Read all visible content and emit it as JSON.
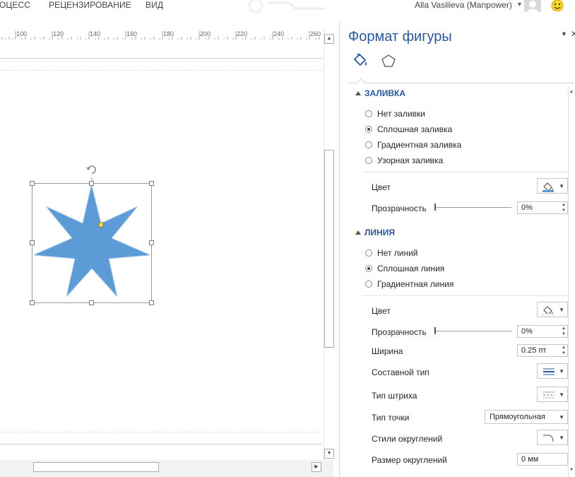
{
  "ribbon": {
    "tabs": [
      "ОЦЕСС",
      "РЕЦЕНЗИРОВАНИЕ",
      "ВИД"
    ],
    "user": "Alla Vasilieva (Manpower)"
  },
  "ruler": {
    "marks": [
      "100",
      "120",
      "140",
      "160",
      "180",
      "200",
      "220",
      "240",
      "260"
    ]
  },
  "shape": {
    "type": "7-point star",
    "fill_color": "#5b9bd5"
  },
  "panel": {
    "title": "Формат фигуры",
    "tabs": [
      "fill-and-line-icon",
      "effects-pentagon-icon"
    ],
    "fill": {
      "heading": "ЗАЛИВКА",
      "options": [
        {
          "label": "Нет заливки",
          "selected": false
        },
        {
          "label": "Сплошная заливка",
          "selected": true
        },
        {
          "label": "Градиентная заливка",
          "selected": false
        },
        {
          "label": "Узорная заливка",
          "selected": false
        }
      ],
      "color_label": "Цвет",
      "transparency_label": "Прозрачность",
      "transparency_value": "0%"
    },
    "line": {
      "heading": "ЛИНИЯ",
      "options": [
        {
          "label": "Нет линий",
          "selected": false
        },
        {
          "label": "Сплошная линия",
          "selected": true
        },
        {
          "label": "Градиентная линия",
          "selected": false
        }
      ],
      "color_label": "Цвет",
      "transparency_label": "Прозрачность",
      "transparency_value": "0%",
      "width_label": "Ширина",
      "width_value": "0.25 пт",
      "compound_label": "Составной тип",
      "dash_label": "Тип штриха",
      "cap_label": "Тип точки",
      "cap_value": "Прямоугольная",
      "round_styles_label": "Стили округлений",
      "round_size_label": "Размер округлений",
      "round_size_value": "0 мм"
    }
  },
  "colors": {
    "accent": "#2b579a",
    "shape_fill": "#5b9bd5"
  }
}
